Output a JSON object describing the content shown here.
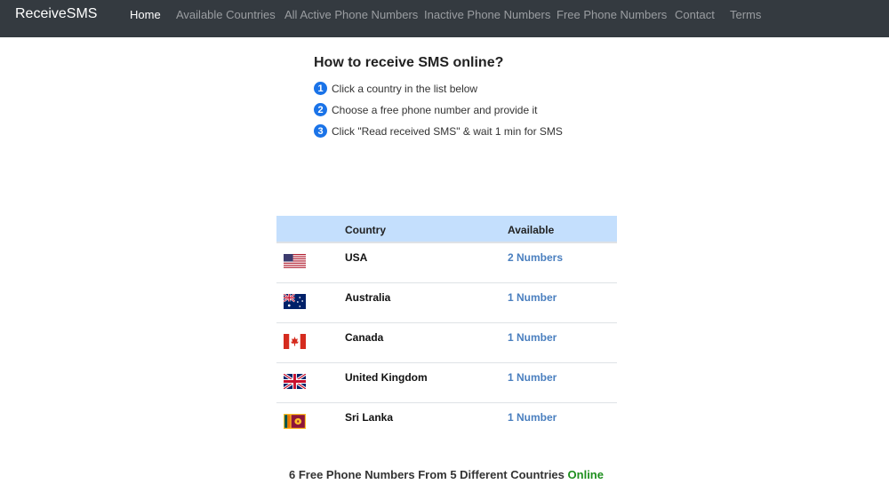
{
  "navbar": {
    "brand": "ReceiveSMS",
    "items": [
      {
        "label": "Home",
        "active": true
      },
      {
        "label": "Available Countries",
        "active": false
      },
      {
        "label": "All Active Phone Numbers",
        "active": false
      },
      {
        "label": "Inactive Phone Numbers",
        "active": false
      },
      {
        "label": "Free Phone Numbers",
        "active": false
      },
      {
        "label": "Contact",
        "active": false
      },
      {
        "label": "Terms",
        "active": false
      }
    ]
  },
  "howto": {
    "title": "How to receive SMS online?",
    "steps": [
      {
        "num": "1",
        "text": "Click a country in the list below"
      },
      {
        "num": "2",
        "text": "Choose a free phone number and provide it"
      },
      {
        "num": "3",
        "text": "Click \"Read received SMS\" & wait 1 min for SMS"
      }
    ]
  },
  "table": {
    "headers": {
      "country": "Country",
      "available": "Available"
    },
    "rows": [
      {
        "flag": "us-flag-icon",
        "country": "USA",
        "available": "2 Numbers"
      },
      {
        "flag": "australia-flag-icon",
        "country": "Australia",
        "available": "1 Number"
      },
      {
        "flag": "canada-flag-icon",
        "country": "Canada",
        "available": "1 Number"
      },
      {
        "flag": "uk-flag-icon",
        "country": "United Kingdom",
        "available": "1 Number"
      },
      {
        "flag": "sri-lanka-flag-icon",
        "country": "Sri Lanka",
        "available": "1 Number"
      }
    ]
  },
  "footer": {
    "summary": "6 Free Phone Numbers From 5 Different Countries",
    "status": "Online"
  },
  "colors": {
    "navbar_bg": "#343a40",
    "table_header_bg": "#c4dffd",
    "link": "#4a7fbf",
    "online": "#1e8f1e",
    "step_badge": "#1a73e8"
  }
}
